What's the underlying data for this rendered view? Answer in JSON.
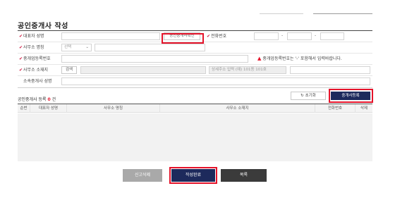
{
  "page": {
    "title": "공인중개사 작성"
  },
  "form": {
    "rep_name_label": "대표자 성명",
    "agent_name_button": "공인중개사확인",
    "phone_label": "전화번호",
    "phone_dash": "-",
    "office_name_label": "사무소 명칭",
    "office_select_value": "선택",
    "reg_number_label": "중개업등록번호",
    "reg_warning": "중개업등록번호는 '-' 포함해서 입력바랍니다.",
    "office_addr_label": "사무소 소재지",
    "addr_search_button": "검색",
    "addr_detail_placeholder": "상세주소 입력 (예) 101동 101호",
    "office_intro_label": "소속중개사 성명"
  },
  "list": {
    "header_text": "공인중개사 등록",
    "count": "0",
    "count_unit": "건",
    "reset_button": "초기화",
    "register_button": "중개사등록",
    "columns": [
      "순번",
      "대표자 성명",
      "사무소 명칭",
      "사무소 소재지",
      "전화번호",
      "삭제"
    ]
  },
  "buttons": {
    "cancel": "신고삭제",
    "complete": "작성완료",
    "list": "목록"
  },
  "colors": {
    "accent_red": "#e5132a",
    "navy": "#1d2a5c",
    "required_mark": "#d0143c"
  }
}
